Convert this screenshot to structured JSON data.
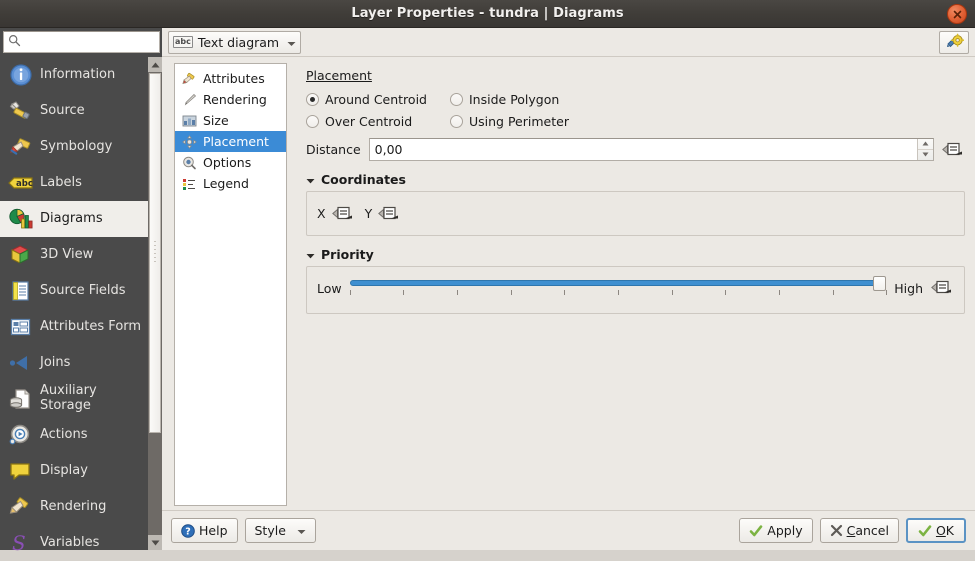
{
  "window": {
    "title": "Layer Properties - tundra | Diagrams",
    "close_icon": "close-icon"
  },
  "search": {
    "value": "",
    "placeholder": "",
    "icon": "search-icon"
  },
  "toolbar": {
    "diagram_type_combo": {
      "badge": "abc",
      "label": "Text diagram",
      "icon": "chevron-down-icon"
    },
    "style_tool_icon": "style-gear-icon"
  },
  "sidebar": {
    "items": [
      {
        "label": "Information",
        "icon": "information-icon",
        "selected": false
      },
      {
        "label": "Source",
        "icon": "source-icon",
        "selected": false
      },
      {
        "label": "Symbology",
        "icon": "symbology-icon",
        "selected": false
      },
      {
        "label": "Labels",
        "icon": "labels-icon",
        "selected": false
      },
      {
        "label": "Diagrams",
        "icon": "diagrams-icon",
        "selected": true
      },
      {
        "label": "3D View",
        "icon": "3d-view-icon",
        "selected": false
      },
      {
        "label": "Source Fields",
        "icon": "source-fields-icon",
        "selected": false
      },
      {
        "label": "Attributes Form",
        "icon": "attributes-form-icon",
        "selected": false
      },
      {
        "label": "Joins",
        "icon": "joins-icon",
        "selected": false
      },
      {
        "label": "Auxiliary Storage",
        "icon": "auxiliary-storage-icon",
        "selected": false
      },
      {
        "label": "Actions",
        "icon": "actions-icon",
        "selected": false
      },
      {
        "label": "Display",
        "icon": "display-icon",
        "selected": false
      },
      {
        "label": "Rendering",
        "icon": "rendering-icon",
        "selected": false
      },
      {
        "label": "Variables",
        "icon": "variables-icon",
        "selected": false
      }
    ],
    "scrollbar": {
      "up_icon": "scroll-up-icon",
      "down_icon": "scroll-down-icon"
    }
  },
  "inner_list": {
    "items": [
      {
        "label": "Attributes",
        "icon": "attributes-icon",
        "selected": false
      },
      {
        "label": "Rendering",
        "icon": "rendering-brush-icon",
        "selected": false
      },
      {
        "label": "Size",
        "icon": "size-icon",
        "selected": false
      },
      {
        "label": "Placement",
        "icon": "placement-icon",
        "selected": true
      },
      {
        "label": "Options",
        "icon": "options-icon",
        "selected": false
      },
      {
        "label": "Legend",
        "icon": "legend-icon",
        "selected": false
      }
    ]
  },
  "placement": {
    "title": "Placement",
    "options": [
      {
        "label": "Around Centroid",
        "checked": true
      },
      {
        "label": "Inside Polygon",
        "checked": false
      },
      {
        "label": "Over Centroid",
        "checked": false
      },
      {
        "label": "Using Perimeter",
        "checked": false
      }
    ],
    "distance": {
      "label": "Distance",
      "value": "0,00",
      "placeholder": "0,00",
      "up_icon": "spin-up-icon",
      "down_icon": "spin-down-icon",
      "override_icon": "data-defined-override-icon"
    }
  },
  "coordinates": {
    "title": "Coordinates",
    "caret": "caret-down-icon",
    "x_label": "X",
    "y_label": "Y",
    "x_override_icon": "data-defined-override-icon",
    "y_override_icon": "data-defined-override-icon"
  },
  "priority": {
    "title": "Priority",
    "caret": "caret-down-icon",
    "low_label": "Low",
    "high_label": "High",
    "value_percent": 100,
    "tick_count": 10,
    "override_icon": "data-defined-override-icon"
  },
  "buttons": {
    "help": {
      "label": "Help",
      "icon": "help-icon"
    },
    "style": {
      "label": "Style",
      "icon": "chevron-down-icon"
    },
    "apply": {
      "label": "Apply",
      "icon": "check-icon"
    },
    "cancel": {
      "label": "Cancel",
      "icon": "cross-icon",
      "mnemonic": "C"
    },
    "ok": {
      "label": "OK",
      "icon": "check-icon",
      "mnemonic": "O"
    }
  },
  "colors": {
    "titlebar": "#403d39",
    "sidebar": "#4a4a4a",
    "dialog_bg": "#ece9e4",
    "selection_blue": "#3b8bd6",
    "slider_blue": "#3f8fd0",
    "close_orange": "#e3663a",
    "check_green": "#7cb342"
  }
}
